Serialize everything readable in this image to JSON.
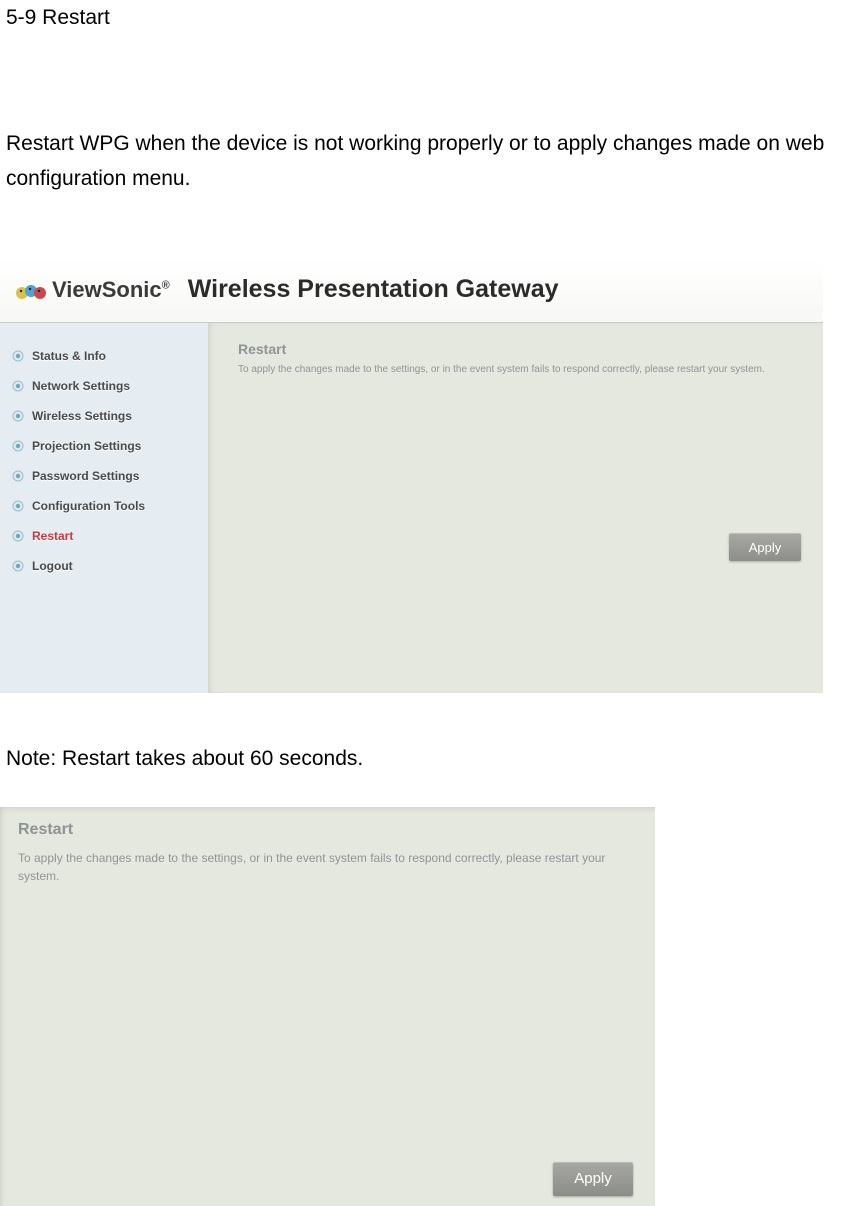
{
  "doc": {
    "section_title": "5-9 Restart",
    "intro": "Restart WPG when the device is not working properly or to apply changes made on web configuration menu.",
    "note": "Note: Restart takes about 60 seconds."
  },
  "screenshot1": {
    "brand": "ViewSonic",
    "brand_mark": "®",
    "title": "Wireless Presentation Gateway",
    "sidebar": {
      "items": [
        {
          "label": "Status & Info",
          "active": false
        },
        {
          "label": "Network Settings",
          "active": false
        },
        {
          "label": "Wireless Settings",
          "active": false
        },
        {
          "label": "Projection Settings",
          "active": false
        },
        {
          "label": "Password Settings",
          "active": false
        },
        {
          "label": "Configuration Tools",
          "active": false
        },
        {
          "label": "Restart",
          "active": true
        },
        {
          "label": "Logout",
          "active": false
        }
      ]
    },
    "content": {
      "heading": "Restart",
      "desc": "To apply the changes made to the settings, or in the event system fails to respond correctly, please restart your system.",
      "apply_label": "Apply"
    }
  },
  "screenshot2": {
    "heading": "Restart",
    "desc": "To apply the changes made to the settings, or in the event system fails to respond correctly, please restart your system.",
    "apply_label": "Apply"
  }
}
